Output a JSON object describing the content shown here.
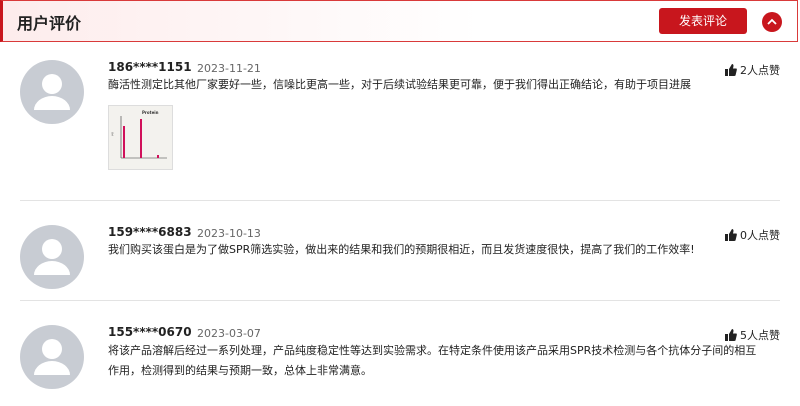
{
  "header": {
    "title": "用户评价",
    "post_button": "发表评论"
  },
  "reviews": [
    {
      "user": "186****1151",
      "date": "2023-11-21",
      "likes": "2人点赞",
      "content": "酶活性测定比其他厂家要好一些，信噪比更高一些，对于后续试验结果更可靠，便于我们得出正确结论，有助于项目进展",
      "thumbnail_title": "Protein"
    },
    {
      "user": "159****6883",
      "date": "2023-10-13",
      "likes": "0人点赞",
      "content": "我们购买该蛋白是为了做SPR筛选实验，做出来的结果和我们的预期很相近，而且发货速度很快，提高了我们的工作效率!"
    },
    {
      "user": "155****0670",
      "date": "2023-03-07",
      "likes": "5人点赞",
      "content_line1": "将该产品溶解后经过一系列处理，产品纯度稳定性等达到实验需求。在特定条件使用该产品采用SPR技术检测与各个抗体分子间的相互",
      "content_line2": "作用，检测得到的结果与预期一致，总体上非常满意。"
    }
  ],
  "colors": {
    "accent": "#c8161d",
    "avatar": "#c8ccd3"
  }
}
